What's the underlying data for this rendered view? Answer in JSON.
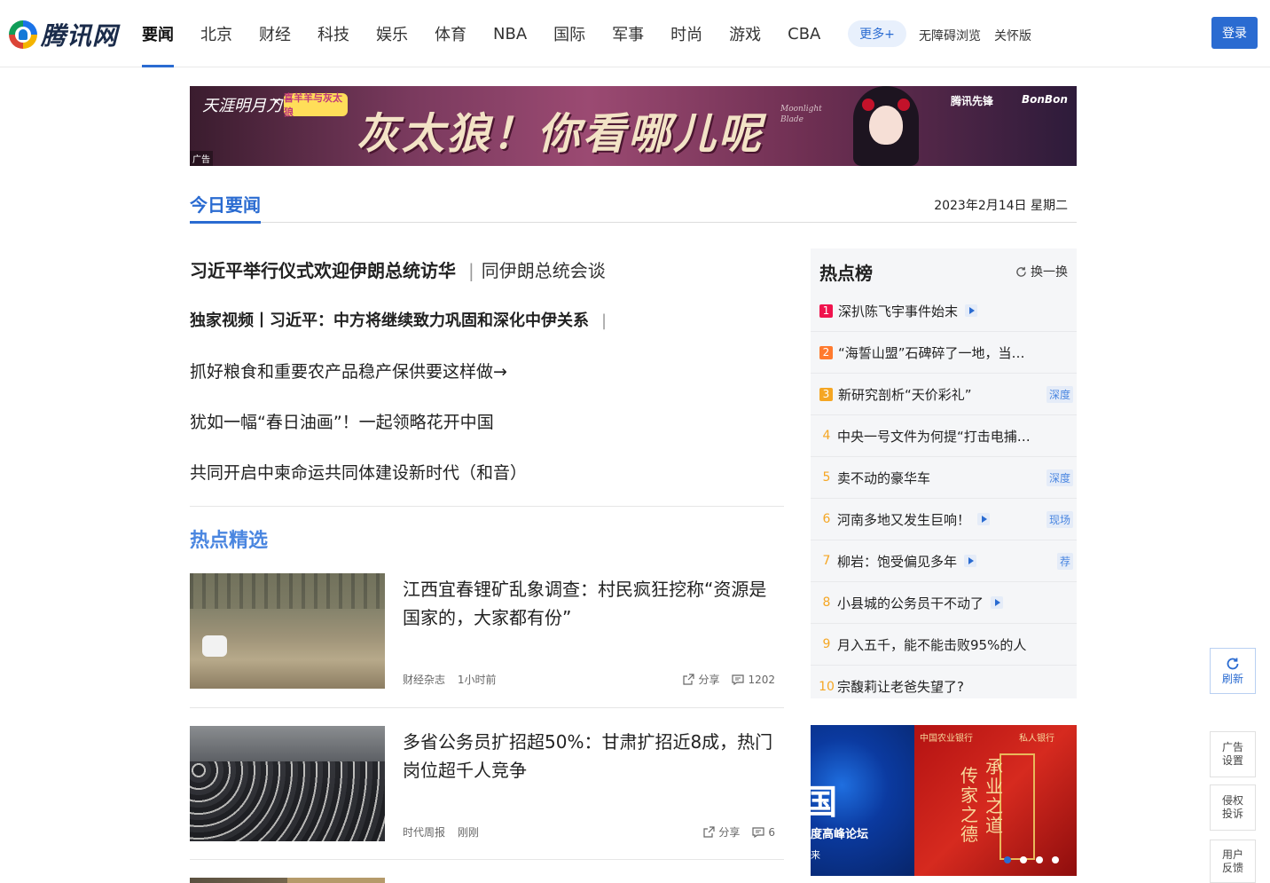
{
  "header": {
    "logo_text": "腾讯网",
    "nav": [
      "要闻",
      "北京",
      "财经",
      "科技",
      "娱乐",
      "体育",
      "NBA",
      "国际",
      "军事",
      "时尚",
      "游戏",
      "CBA"
    ],
    "more_label": "更多+",
    "accessibility_label": "无障碍浏览",
    "care_label": "关怀版",
    "login_label": "登录"
  },
  "banner_ad": {
    "brand_left": "天涯明月刀",
    "brand_x": "×",
    "brand_collab": "喜羊羊与灰太狼",
    "headline": "灰太狼！你看哪儿呢",
    "subtitle": "Moonlight Blade",
    "brand_pioneer": "腾讯先锋",
    "brand_bonbon": "BonBon",
    "ad_tag": "广告"
  },
  "today": {
    "title": "今日要闻",
    "date": "2023年2月14日 星期二"
  },
  "headlines": {
    "h1_main": "习近平举行仪式欢迎伊朗总统访华",
    "h1_sep": "|",
    "h1_sub": "同伊朗总统会谈",
    "h2_main": "独家视频丨习近平：中方将继续致力巩固和深化中伊关系",
    "h2_sep": "|",
    "h3": "抓好粮食和重要农产品稳产保供要这样做→",
    "h4": "犹如一幅“春日油画”！一起领略花开中国",
    "h5": "共同开启中柬命运共同体建设新时代（和音）"
  },
  "hot_picks": {
    "title": "热点精选",
    "items": [
      {
        "title": "江西宜春锂矿乱象调查：村民疯狂挖称“资源是国家的，大家都有份”",
        "source": "财经杂志",
        "time": "1小时前",
        "share_label": "分享",
        "comments": "1202"
      },
      {
        "title": "多省公务员扩招超50%：甘肃扩招近8成，热门岗位超千人竞争",
        "source": "时代周报",
        "time": "刚刚",
        "share_label": "分享",
        "comments": "6"
      }
    ]
  },
  "hotlist": {
    "title": "热点榜",
    "refresh_label": "换一换",
    "items": [
      {
        "rank": "1",
        "text": "深扒陈飞宇事件始末",
        "video": true,
        "tag": ""
      },
      {
        "rank": "2",
        "text": "“海誓山盟”石碑碎了一地，当…",
        "video": false,
        "tag": ""
      },
      {
        "rank": "3",
        "text": "新研究剖析“天价彩礼”",
        "video": false,
        "tag": "深度"
      },
      {
        "rank": "4",
        "text": "中央一号文件为何提“打击电捕…",
        "video": false,
        "tag": ""
      },
      {
        "rank": "5",
        "text": "卖不动的豪华车",
        "video": false,
        "tag": "深度"
      },
      {
        "rank": "6",
        "text": "河南多地又发生巨响！",
        "video": true,
        "tag": "现场"
      },
      {
        "rank": "7",
        "text": "柳岩：饱受偏见多年",
        "video": true,
        "tag": "荐"
      },
      {
        "rank": "8",
        "text": "小县城的公务员干不动了",
        "video": true,
        "tag": ""
      },
      {
        "rank": "9",
        "text": "月入五千，能不能击败95%的人",
        "video": false,
        "tag": ""
      },
      {
        "rank": "10",
        "text": "宗馥莉让老爸失望了?",
        "video": false,
        "tag": ""
      }
    ],
    "rank_colors": [
      "#f0134d",
      "#ff7a2e",
      "#f5a623"
    ]
  },
  "side_ad": {
    "left_big": "国",
    "left_line": "度高峰论坛",
    "left_small": "来",
    "bank_name": "中国农业银行",
    "bank_private": "私人银行",
    "poem_left": "传家之德",
    "poem_right": "承业之道"
  },
  "float_tools": {
    "refresh_label": "刷新",
    "ad_settings": "广告设置",
    "report": "侵权投诉",
    "feedback": "用户反馈"
  },
  "colors": {
    "accent": "#2a6bd1",
    "hot_title": "#4a86e0"
  }
}
